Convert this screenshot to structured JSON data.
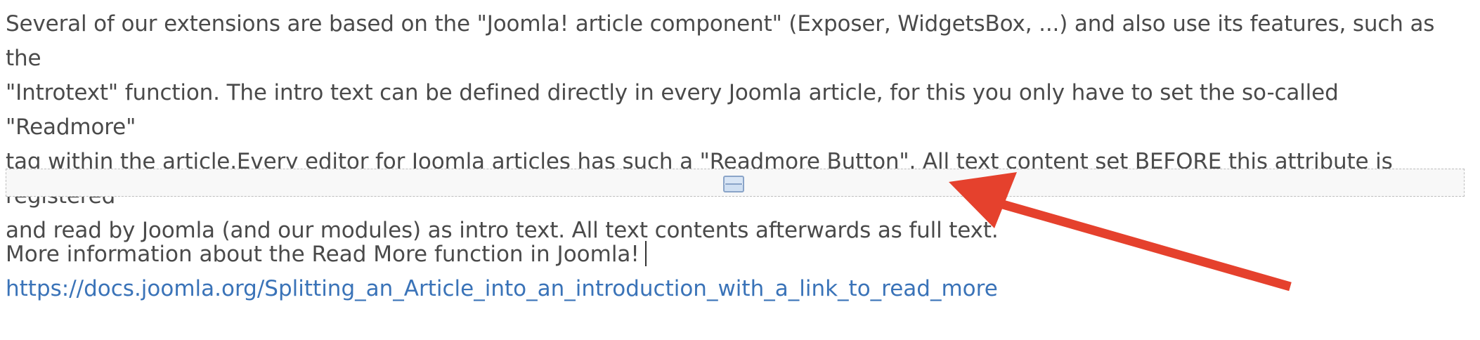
{
  "content": {
    "intro_paragraph": "Several of our extensions are based on the \"Joomla! article component\" (Exposer, WidgetsBox, ...) and also use its features, such as the\n\"Introtext\" function. The intro text can be defined directly in every Joomla article, for this you only have to set the so-called \"Readmore\"\ntag within the article.Every editor for Joomla articles has such a \"Readmore Button\". All text content set BEFORE this attribute is registered\nand read by Joomla (and our modules) as intro text. All text contents afterwards as full text.",
    "readmore_separator_icon": "readmore-separator-icon",
    "more_info_text": "More information about the Read More function in Joomla!",
    "docs_link": "https://docs.joomla.org/Splitting_an_Article_into_an_introduction_with_a_link_to_read_more"
  },
  "annotation": {
    "arrow_color": "#e5412d"
  },
  "colors": {
    "body_text": "#4a4a4a",
    "link": "#3a73b8",
    "separator_border": "#bdbdbd",
    "separator_bg": "#f8f8f8"
  }
}
